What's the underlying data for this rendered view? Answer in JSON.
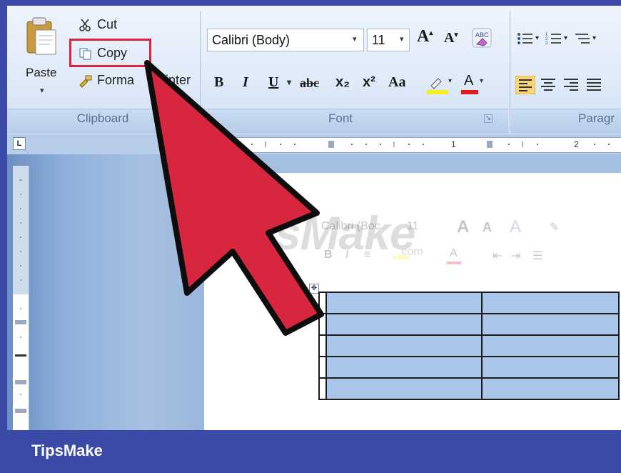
{
  "ribbon": {
    "clipboard": {
      "paste_label": "Paste",
      "cut_label": "Cut",
      "copy_label": "Copy",
      "format_painter_label": "Format Painter",
      "format_painter_visible": "Forma",
      "format_painter_tail": "inter",
      "group_label": "Clipboard"
    },
    "font": {
      "font_name": "Calibri (Body)",
      "font_size": "11",
      "group_label": "Font",
      "buttons": [
        "B",
        "I",
        "U",
        "abc",
        "x₂",
        "x²",
        "Aa",
        "A"
      ]
    },
    "paragraph": {
      "group_label": "Paragr"
    }
  },
  "ruler": {
    "corner": "L",
    "marks": [
      "1",
      "2"
    ]
  },
  "mini_toolbar": {
    "font_name": "Calibri (Boc",
    "font_size": "11"
  },
  "watermark": {
    "text": "TipsMake",
    "suffix": ".com"
  },
  "table": {
    "rows": 5,
    "cols": 2
  },
  "footer": {
    "brand": "TipsMake"
  },
  "colors": {
    "arrow": "#d7263d",
    "highlight_box": "#d7263d",
    "table_cell": "#a9c7ea",
    "frame": "#3a4aa6"
  },
  "icons": [
    "paste-icon",
    "scissors-icon",
    "copy-icon",
    "format-painter-icon",
    "grow-font-icon",
    "shrink-font-icon",
    "clear-format-icon",
    "bullets-icon",
    "numbering-icon",
    "multilevel-list-icon",
    "highlight-icon",
    "font-color-icon",
    "align-left-icon",
    "align-center-icon",
    "align-right-icon",
    "justify-icon",
    "arrow-pointer-icon"
  ]
}
